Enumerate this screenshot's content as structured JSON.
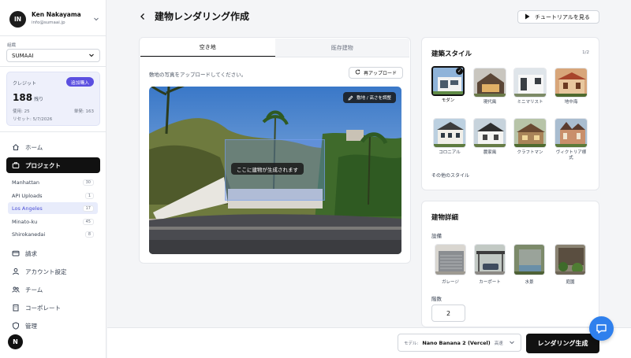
{
  "user": {
    "initials": "IN",
    "name": "Ken Nakayama",
    "email": "info@sumaai.jp"
  },
  "org": {
    "label": "組織",
    "selected": "SUMAAI"
  },
  "credits": {
    "label": "クレジット",
    "buy_label": "追加購入",
    "remaining": "188",
    "remaining_unit": "残り",
    "used": "使用: 25",
    "unit_price": "単発: 163",
    "reset": "リセット: 5/7/2026"
  },
  "nav": {
    "home": "ホーム",
    "projects": "プロジェクト",
    "billing": "請求",
    "account": "アカウント設定",
    "team": "チーム",
    "corporate": "コーポレート",
    "admin": "管理"
  },
  "projects": [
    {
      "name": "Manhattan",
      "count": "30"
    },
    {
      "name": "API Uploads",
      "count": "1"
    },
    {
      "name": "Los Angeles",
      "count": "17"
    },
    {
      "name": "Minato-ku",
      "count": "45"
    },
    {
      "name": "Shirokanedai",
      "count": "8"
    }
  ],
  "sidebar_badge": "N",
  "header": {
    "title": "建物レンダリング作成",
    "tutorial_label": "チュートリアルを見る"
  },
  "site": {
    "tabs": [
      "空き地",
      "既存建物"
    ],
    "hint": "敷地の写真をアップロードしてください。",
    "reupload_label": "再アップロード",
    "adjust_label": "敷地 / 高さを調整",
    "placeholder_label": "ここに建物が生成されます"
  },
  "style": {
    "title": "建築スタイル",
    "pager": "1/2",
    "items": [
      "モダン",
      "現代風",
      "ミニマリスト",
      "地中海",
      "コロニアル",
      "農家風",
      "クラフトマン",
      "ヴィクトリア様式"
    ],
    "more_label": "その他のスタイル"
  },
  "details": {
    "title": "建物詳細",
    "facilities_label": "設備",
    "facilities": [
      "ガレージ",
      "カーポート",
      "水景",
      "庭園"
    ],
    "floors_label": "階数",
    "floors_value": "2"
  },
  "footer": {
    "model_label": "モデル:",
    "model_value": "Nano Banana 2 (Vercel)",
    "model_speed": "高速",
    "render_label": "レンダリング生成"
  },
  "icons": {
    "home": "home-icon",
    "projects": "briefcase-icon",
    "billing": "card-icon",
    "account": "user-icon",
    "team": "team-icon",
    "corporate": "building-icon",
    "admin": "shield-icon",
    "chat": "chat-icon"
  },
  "colors": {
    "accent": "#5b4fe0",
    "primary": "#111111",
    "active_project": "#4b4fd6",
    "chat": "#2f80ed"
  }
}
